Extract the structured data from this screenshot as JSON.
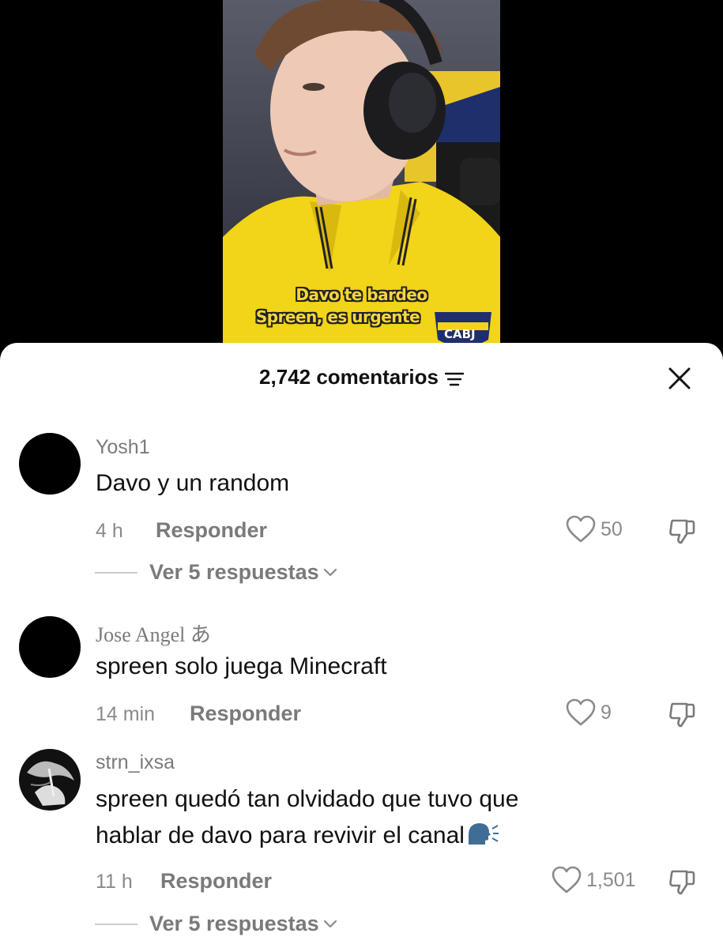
{
  "video": {
    "caption_line1": "Davo te bardeo",
    "caption_line2": "Spreen, es urgente",
    "badge_text": "CABJ"
  },
  "sheet": {
    "comment_count": "2,742 comentarios"
  },
  "comments": [
    {
      "username": "Yosh1",
      "text": "Davo y un random",
      "time": "4 h",
      "reply_label": "Responder",
      "likes": "50",
      "view_replies": "Ver 5 respuestas"
    },
    {
      "username": "Jose Angel あ",
      "text": "spreen solo juega Minecraft",
      "time": "14 min",
      "reply_label": "Responder",
      "likes": "9"
    },
    {
      "username": "strn_ixsa",
      "text_line1": "spreen quedó tan olvidado que tuvo que",
      "text_line2": "hablar de davo para revivir el canal",
      "time": "11 h",
      "reply_label": "Responder",
      "likes": "1,501",
      "view_replies": "Ver 5 respuestas"
    }
  ],
  "icons": [
    "filter-icon",
    "close-icon",
    "heart-icon",
    "dislike-icon",
    "chevron-down-icon",
    "speaking-head-icon"
  ],
  "colors": {
    "sheet_bg": "#ffffff",
    "text": "#111111",
    "muted": "#7a7a7a",
    "caption": "#f6d63a"
  }
}
